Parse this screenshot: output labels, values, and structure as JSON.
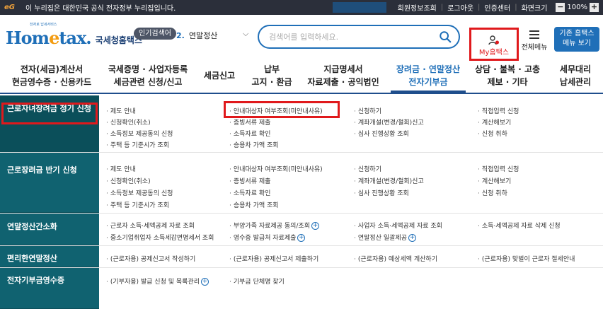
{
  "topbar": {
    "notice": "이 누리집은 대한민국 공식 전자정부 누리집입니다.",
    "gov_logo": "eG",
    "links": [
      "회원정보조회",
      "로그아웃",
      "인증센터",
      "화면크기"
    ],
    "zoom_minus": "−",
    "zoom_value": "100%",
    "zoom_plus": "+"
  },
  "header": {
    "logo_small": "전자로 납세서비스",
    "logo_main_a": "Hom",
    "logo_main_dot": "e",
    "logo_main_b": "tax.",
    "logo_kr": "국세청홈택스",
    "popular_tag": "인기검색어",
    "popular_num": "2.",
    "popular_text": "연말정산",
    "search_placeholder": "검색어를 입력하세요.",
    "my_label": "My홈택스",
    "allmenu_label": "전체메뉴",
    "classic_line1": "기존 홈택스",
    "classic_line2": "메뉴 보기"
  },
  "nav": [
    {
      "l1": "전자(세금)계산서",
      "l2": "현금영수증 · 신용카드"
    },
    {
      "l1": "국세증명 · 사업자등록",
      "l2": "세금관련 신청/신고"
    },
    {
      "l1": "세금신고",
      "l2": ""
    },
    {
      "l1": "납부",
      "l2": "고지 · 환급"
    },
    {
      "l1": "지급명세서",
      "l2": "자료제출 · 공익법인"
    },
    {
      "l1": "장려금 · 연말정산",
      "l2": "전자기부금"
    },
    {
      "l1": "상담 · 불복 · 고충",
      "l2": "제보 · 기타"
    },
    {
      "l1": "세무대리",
      "l2": "납세관리"
    }
  ],
  "sections": [
    {
      "title": "근로자녀장려금 정기 신청",
      "cols": [
        [
          "제도 안내",
          "신청확인(취소)",
          "소득정보 제공동의 신청",
          "주택 등 기준시가 조회"
        ],
        [
          "안내대상자 여부조회(미안내사유)",
          "증빙서류 제출",
          "소득자료 확인",
          "승용차 가액 조회"
        ],
        [
          "신청하기",
          "계좌개설(변경/철회)신고",
          "심사 진행상황 조회"
        ],
        [
          "직접입력 신청",
          "계산해보기",
          "신청 취하"
        ]
      ]
    },
    {
      "title": "근로장려금 반기 신청",
      "cols": [
        [
          "제도 안내",
          "신청확인(취소)",
          "소득정보 제공동의 신청",
          "주택 등 기준시가 조회"
        ],
        [
          "안내대상자 여부조회(미안내사유)",
          "증빙서류 제출",
          "소득자료 확인",
          "승용차 가액 조회"
        ],
        [
          "신청하기",
          "계좌개설(변경/철회)신고",
          "심사 진행상황 조회"
        ],
        [
          "직접입력 신청",
          "계산해보기",
          "신청 취하"
        ]
      ]
    },
    {
      "title": "연말정산간소화",
      "cols": [
        [
          "근로자 소득·세액공제 자료 조회",
          "중소기업취업자 소득세감면명세서 조회"
        ],
        [
          "부양가족 자료제공 동의/조회",
          "영수증 발급처 자료제출"
        ],
        [
          "사업자 소득·세액공제 자료 조회",
          "연말정산 일괄제공"
        ],
        [
          "소득·세액공제 자료 삭제 신청"
        ]
      ]
    },
    {
      "title": "편리한연말정산",
      "cols": [
        [
          "(근로자용) 공제신고서 작성하기"
        ],
        [
          "(근로자용) 공제신고서 제출하기"
        ],
        [
          "(근로자용) 예상세액 계산하기"
        ],
        [
          "(근로자용) 맞벌이 근로자 절세안내"
        ]
      ]
    },
    {
      "title": "전자기부금영수증",
      "cols": [
        [
          "(기부자용) 발급 신청 및 목록관리"
        ],
        [
          "기부금 단체명 찾기"
        ]
      ]
    }
  ]
}
